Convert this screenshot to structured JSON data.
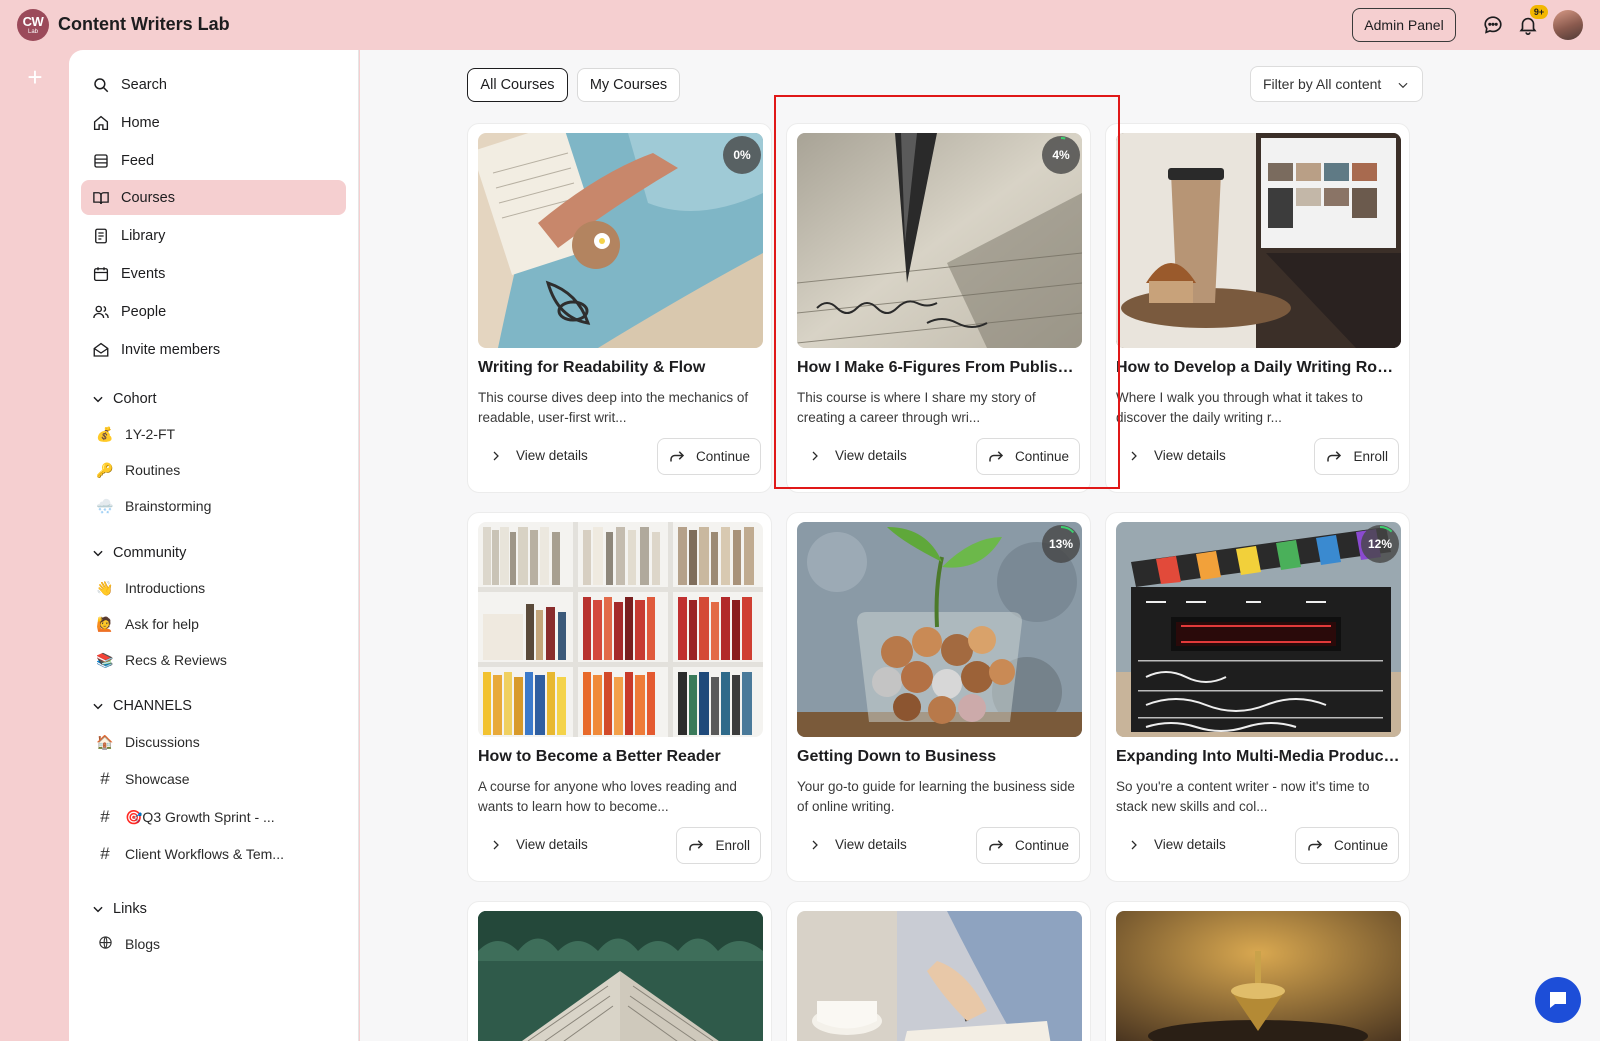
{
  "topbar": {
    "logo_line1": "CW",
    "logo_line2": "Lab",
    "brand": "Content Writers Lab",
    "admin_panel": "Admin Panel",
    "notif_badge": "9+"
  },
  "sidebar": {
    "search": "Search",
    "nav": [
      {
        "label": "Home",
        "icon": "home-icon"
      },
      {
        "label": "Feed",
        "icon": "feed-icon"
      },
      {
        "label": "Courses",
        "icon": "book-open-icon",
        "active": true
      },
      {
        "label": "Library",
        "icon": "document-icon"
      },
      {
        "label": "Events",
        "icon": "calendar-icon"
      },
      {
        "label": "People",
        "icon": "people-icon"
      },
      {
        "label": "Invite members",
        "icon": "mail-open-icon"
      }
    ],
    "sections": [
      {
        "title": "Cohort",
        "items": [
          {
            "emoji": "💰",
            "label": "1Y-2-FT"
          },
          {
            "emoji": "🔑",
            "label": "Routines"
          },
          {
            "emoji": "🌨️",
            "label": "Brainstorming"
          }
        ]
      },
      {
        "title": "Community",
        "items": [
          {
            "emoji": "👋",
            "label": "Introductions"
          },
          {
            "emoji": "🙋",
            "label": "Ask for help"
          },
          {
            "emoji": "📚",
            "label": "Recs & Reviews"
          }
        ]
      },
      {
        "title": "CHANNELS",
        "items": [
          {
            "emoji": "🏠",
            "label": "Discussions"
          },
          {
            "emoji": "#",
            "label": "Showcase"
          },
          {
            "emoji": "#",
            "label": "🎯Q3 Growth Sprint - ..."
          },
          {
            "emoji": "#",
            "label": "Client Workflows & Tem..."
          }
        ]
      },
      {
        "title": "Links",
        "items": [
          {
            "emoji": "globe",
            "label": "Blogs"
          }
        ]
      }
    ]
  },
  "main": {
    "tabs": [
      {
        "label": "All Courses",
        "active": true
      },
      {
        "label": "My Courses",
        "active": false
      }
    ],
    "filter": "Filter by All content",
    "view_details": "View details",
    "courses": [
      {
        "title": "Writing for Readability & Flow",
        "desc": "This course dives deep into the mechanics of readable, user-first writ...",
        "progress": "0%",
        "progress_value": 0,
        "action": "Continue"
      },
      {
        "title": "How I Make 6-Figures From Publishi...",
        "desc": "This course is where I share my story of creating a career through wri...",
        "progress": "4%",
        "progress_value": 4,
        "action": "Continue"
      },
      {
        "title": "How to Develop a Daily Writing Rout...",
        "desc": "Where I walk you through what it takes to discover the daily writing r...",
        "progress": "",
        "progress_value": null,
        "action": "Enroll"
      },
      {
        "title": "How to Become a Better Reader",
        "desc": "A course for anyone who loves reading and wants to learn how to become...",
        "progress": "",
        "progress_value": null,
        "action": "Enroll"
      },
      {
        "title": "Getting Down to Business",
        "desc": "Your go-to guide for learning the business side of online writing.",
        "progress": "13%",
        "progress_value": 13,
        "action": "Continue"
      },
      {
        "title": "Expanding Into Multi-Media Product...",
        "desc": "So you're a content writer - now it's time to stack new skills and col...",
        "progress": "12%",
        "progress_value": 12,
        "action": "Continue"
      }
    ],
    "colors": {
      "accent": "#f5cfd0",
      "highlight": "#e01818",
      "fab": "#1d4ed8",
      "progress_ring": "#3ccf6e"
    }
  }
}
